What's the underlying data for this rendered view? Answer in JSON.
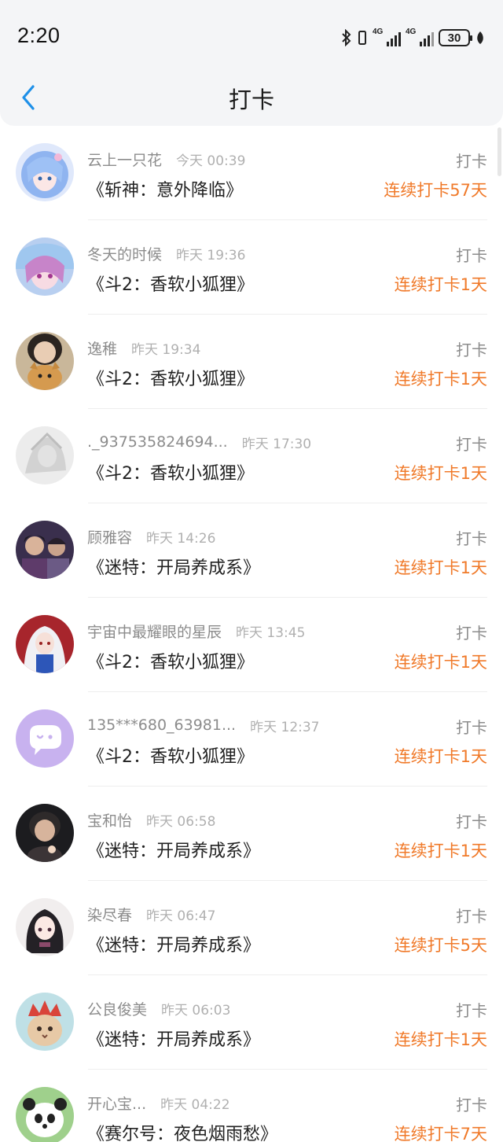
{
  "status": {
    "time": "2:20",
    "battery": "30",
    "network1": "4G",
    "network2": "4G"
  },
  "header": {
    "title": "打卡"
  },
  "colors": {
    "accent": "#1e90e8",
    "streak": "#f07a2a",
    "meta": "#8c8c8c"
  },
  "items": [
    {
      "name": "云上一只花",
      "time": "今天 00:39",
      "book": "《斩神：意外降临》",
      "action": "打卡",
      "streak": "连续打卡57天",
      "avatar": "anime-blue-hair"
    },
    {
      "name": "冬天的时候",
      "time": "昨天 19:36",
      "book": "《斗2：香软小狐狸》",
      "action": "打卡",
      "streak": "连续打卡1天",
      "avatar": "anime-pink-hair"
    },
    {
      "name": "逸稚",
      "time": "昨天 19:34",
      "book": "《斗2：香软小狐狸》",
      "action": "打卡",
      "streak": "连续打卡1天",
      "avatar": "girl-with-cat"
    },
    {
      "name": "._937535824694...",
      "time": "昨天 17:30",
      "book": "《斗2：香软小狐狸》",
      "action": "打卡",
      "streak": "连续打卡1天",
      "avatar": "grey-sketch"
    },
    {
      "name": "顾雅容",
      "time": "昨天 14:26",
      "book": "《迷特：开局养成系》",
      "action": "打卡",
      "streak": "连续打卡1天",
      "avatar": "two-people"
    },
    {
      "name": "宇宙中最耀眼的星辰",
      "time": "昨天 13:45",
      "book": "《斗2：香软小狐狸》",
      "action": "打卡",
      "streak": "连续打卡1天",
      "avatar": "anime-white-hair"
    },
    {
      "name": "135***680_63981...",
      "time": "昨天 12:37",
      "book": "《斗2：香软小狐狸》",
      "action": "打卡",
      "streak": "连续打卡1天",
      "avatar": "default-chat-bubble"
    },
    {
      "name": "宝和怡",
      "time": "昨天 06:58",
      "book": "《迷特：开局养成系》",
      "action": "打卡",
      "streak": "连续打卡1天",
      "avatar": "person-dark"
    },
    {
      "name": "染尽春",
      "time": "昨天 06:47",
      "book": "《迷特：开局养成系》",
      "action": "打卡",
      "streak": "连续打卡5天",
      "avatar": "anime-dark-hair"
    },
    {
      "name": "公良俊美",
      "time": "昨天 06:03",
      "book": "《迷特：开局养成系》",
      "action": "打卡",
      "streak": "连续打卡1天",
      "avatar": "cat-with-crown"
    },
    {
      "name": "开心宝...",
      "time": "昨天 04:22",
      "book": "《赛尔号：夜色烟雨愁》",
      "action": "打卡",
      "streak": "连续打卡7天",
      "avatar": "panda"
    }
  ]
}
